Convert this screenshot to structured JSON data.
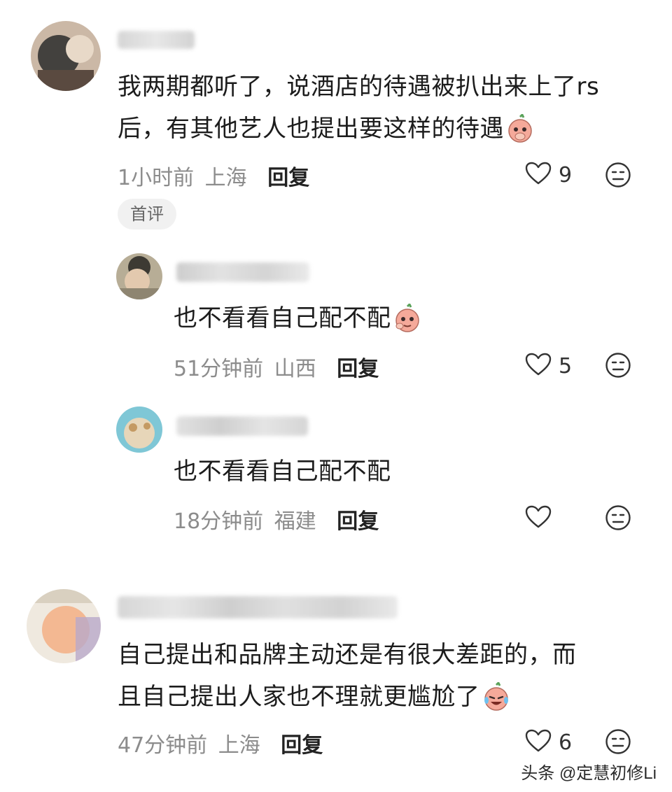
{
  "comments": [
    {
      "text_lines": [
        "我两期都听了，说酒店的待遇被扒出来上了rs",
        "后，有其他艺人也提出要这样的待遇"
      ],
      "time": "1小时前",
      "location": "上海",
      "reply_label": "回复",
      "like_count": "9",
      "badge": "首评",
      "emoji": "covering-mouth-emoji",
      "replies": [
        {
          "text": "也不看看自己配不配",
          "time": "51分钟前",
          "location": "山西",
          "reply_label": "回复",
          "like_count": "5",
          "emoji": "thinking-emoji"
        },
        {
          "text": "也不看看自己配不配",
          "time": "18分钟前",
          "location": "福建",
          "reply_label": "回复",
          "like_count": ""
        }
      ]
    },
    {
      "text_lines": [
        "自己提出和品牌主动还是有很大差距的，而",
        "且自己提出人家也不理就更尴尬了"
      ],
      "time": "47分钟前",
      "location": "上海",
      "reply_label": "回复",
      "like_count": "6",
      "emoji": "laughing-crying-emoji"
    }
  ],
  "icons": {
    "like": "heart-outline-icon",
    "react": "neutral-face-icon"
  },
  "watermark": "头条 @定慧初修Li"
}
